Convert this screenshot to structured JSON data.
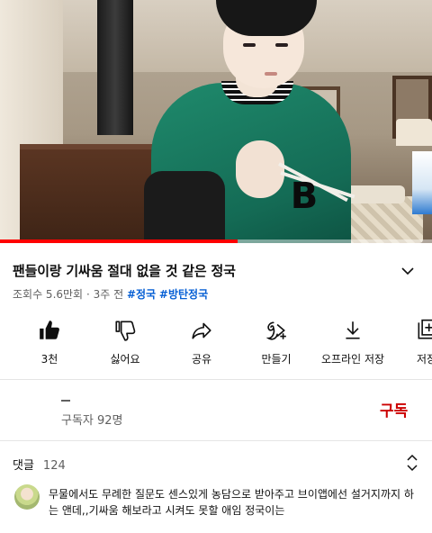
{
  "video": {
    "overlay_letter": "B",
    "progress_fraction": 0.55
  },
  "title": "팬들이랑 기싸움 절대 없을 것 같은 정국",
  "meta": {
    "views": "조회수 5.6만회",
    "age": "3주 전",
    "separator": "·",
    "tags": [
      "#정국",
      "#방탄정국"
    ]
  },
  "actions": [
    {
      "name": "like",
      "label": "3천",
      "icon": "thumbs-up-icon"
    },
    {
      "name": "dislike",
      "label": "싫어요",
      "icon": "thumbs-down-icon"
    },
    {
      "name": "share",
      "label": "공유",
      "icon": "share-icon"
    },
    {
      "name": "remix",
      "label": "만들기",
      "icon": "create-icon"
    },
    {
      "name": "download",
      "label": "오프라인 저장",
      "icon": "download-icon"
    },
    {
      "name": "save",
      "label": "저장",
      "icon": "save-playlist-icon"
    }
  ],
  "channel": {
    "subscribers": "구독자 92명",
    "subscribe_label": "구독"
  },
  "comments": {
    "label": "댓글",
    "count": "124",
    "top_comment": "무물에서도 무례한 질문도 센스있게 농담으로 받아주고 브이앱에선 설거지까지 하는 앤데,,기싸움 해보라고 시켜도 못할 애임 정국이는"
  },
  "colors": {
    "accent_red": "#cc0000",
    "progress_red": "#ff0000",
    "hashtag_blue": "#065fd4",
    "secondary_text": "#606060"
  }
}
